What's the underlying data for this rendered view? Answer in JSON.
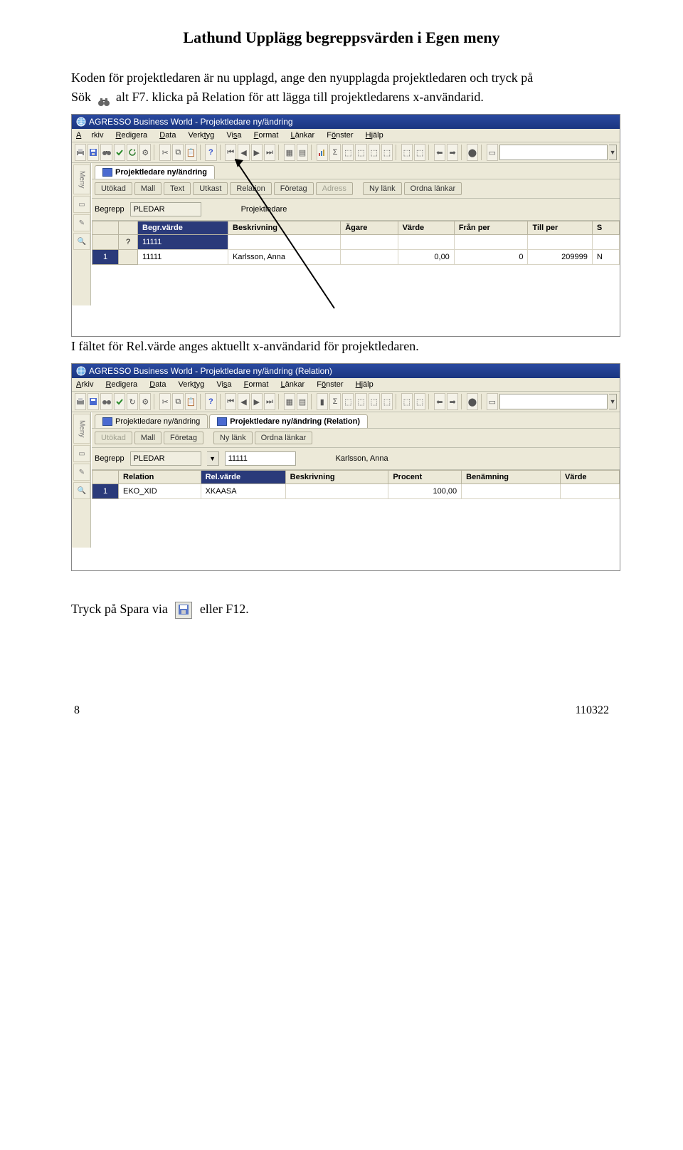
{
  "page_title": "Lathund Upplägg begreppsvärden i Egen meny",
  "para1_a": "Koden för projektledaren är nu upplagd, ange den nyupplagda projektledaren och tryck på",
  "para1_b": "Sök",
  "para1_c": "alt F7. klicka på Relation för att lägga till projektledarens x-användarid.",
  "para2": "I fältet för Rel.värde anges aktuellt x-användarid för projektledaren.",
  "para3_a": "Tryck på Spara via",
  "para3_b": "eller F12.",
  "footer_left": "8",
  "footer_right": "110322",
  "shot1": {
    "title": "AGRESSO Business World - Projektledare ny/ändring",
    "menus": [
      "Arkiv",
      "Redigera",
      "Data",
      "Verktyg",
      "Visa",
      "Format",
      "Länkar",
      "Fönster",
      "Hjälp"
    ],
    "sidelabel": "Meny",
    "tabs": [
      {
        "label": "Projektledare ny/ändring",
        "active": true
      }
    ],
    "pillbar": [
      "Utökad",
      "Mall",
      "Text",
      "Utkast",
      "Relation",
      "Företag",
      "Adress",
      "",
      "Ny länk",
      "Ordna länkar"
    ],
    "pillbar_disabled": [
      "Adress"
    ],
    "begrepp_label": "Begrepp",
    "begrepp_value": "PLEDAR",
    "begrepp_desc": "Projektledare",
    "grid_headers": [
      "",
      "",
      "Begr.värde",
      "Beskrivning",
      "Ägare",
      "Värde",
      "Från per",
      "Till per",
      "S"
    ],
    "grid_rows": [
      {
        "num": "",
        "mark": "?",
        "cells": [
          "11111",
          "",
          "",
          "",
          "",
          "",
          ""
        ]
      },
      {
        "num": "1",
        "mark": "",
        "cells": [
          "11111",
          "Karlsson, Anna",
          "",
          "0,00",
          "0",
          "209999",
          "N"
        ]
      }
    ]
  },
  "shot2": {
    "title": "AGRESSO Business World - Projektledare ny/ändring (Relation)",
    "menus": [
      "Arkiv",
      "Redigera",
      "Data",
      "Verktyg",
      "Visa",
      "Format",
      "Länkar",
      "Fönster",
      "Hjälp"
    ],
    "sidelabel": "Meny",
    "tabs": [
      {
        "label": "Projektledare ny/ändring",
        "active": false
      },
      {
        "label": "Projektledare ny/ändring (Relation)",
        "active": true
      }
    ],
    "pillbar": [
      "Utökad",
      "Mall",
      "Företag",
      "",
      "Ny länk",
      "Ordna länkar"
    ],
    "pillbar_disabled": [
      "Utökad"
    ],
    "begrepp_label": "Begrepp",
    "begrepp_value": "PLEDAR",
    "begrepp_code": "11111",
    "begrepp_desc": "Karlsson, Anna",
    "grid_headers": [
      "",
      "Relation",
      "Rel.värde",
      "Beskrivning",
      "Procent",
      "Benämning",
      "Värde"
    ],
    "grid_rows": [
      {
        "num": "1",
        "cells": [
          "EKO_XID",
          "XKAASA",
          "",
          "100,00",
          "",
          ""
        ]
      }
    ]
  }
}
